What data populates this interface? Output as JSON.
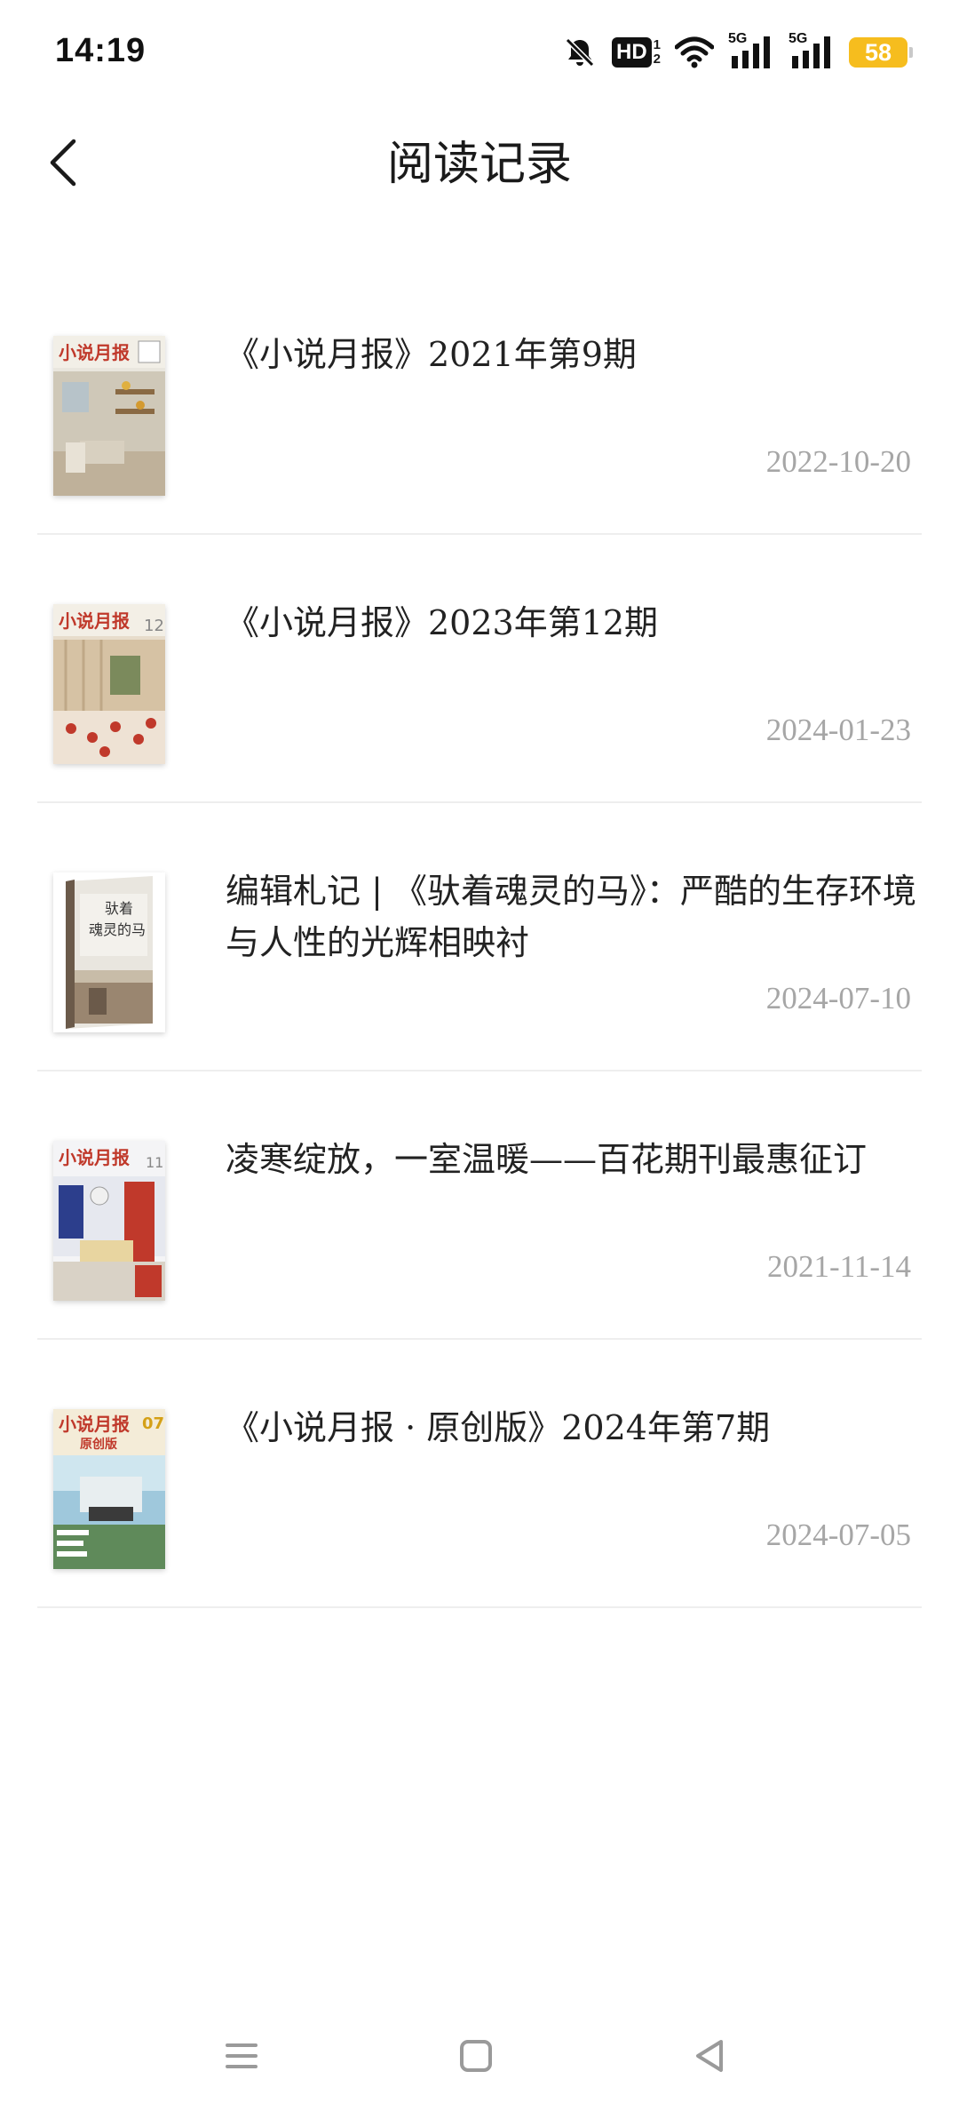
{
  "status_bar": {
    "time": "14:19",
    "icons": [
      "bell-muted-icon",
      "hd-icon",
      "wifi-icon",
      "signal-5g-icon",
      "signal-5g-icon",
      "battery-icon"
    ],
    "hd_label": "HD",
    "hd_sim_top": "1",
    "hd_sim_bottom": "2",
    "signal_label_1": "5G",
    "signal_label_2": "5G",
    "battery_level": "58",
    "battery_color": "#f6bd1e"
  },
  "header": {
    "title": "阅读记录",
    "back_icon": "chevron-left-icon"
  },
  "records": [
    {
      "title": "《小说月报》2021年第9期",
      "date": "2022-10-20",
      "cover": "magazine-cover-xsyb-2021-09"
    },
    {
      "title": "《小说月报》2023年第12期",
      "date": "2024-01-23",
      "cover": "magazine-cover-xsyb-2023-12"
    },
    {
      "title": "编辑札记 | 《驮着魂灵的马》：严酷的生存环境与人性的光辉相映衬",
      "date": "2024-07-10",
      "cover": "book-cover-tuozhe-hunling-de-ma"
    },
    {
      "title": "凌寒绽放，一室温暖——百花期刊最惠征订",
      "date": "2021-11-14",
      "cover": "magazine-cover-xsyb-11"
    },
    {
      "title": "《小说月报 · 原创版》2024年第7期",
      "date": "2024-07-05",
      "cover": "magazine-cover-xsyb-original-2024-07"
    }
  ],
  "nav_bar": {
    "menu_icon": "menu-icon",
    "home_icon": "home-square-icon",
    "back_icon": "back-triangle-icon"
  }
}
